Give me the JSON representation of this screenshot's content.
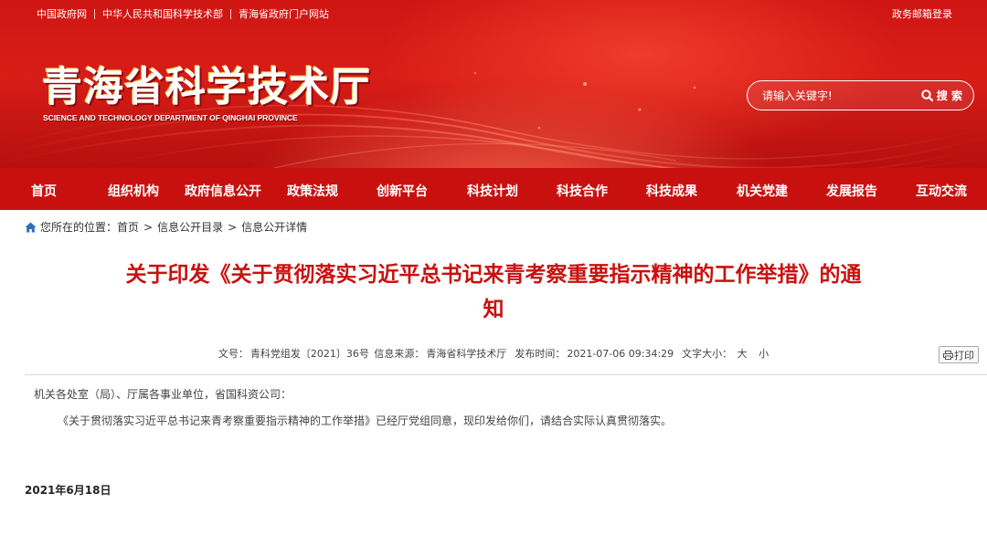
{
  "header": {
    "top_links": [
      "中国政府网",
      "中华人民共和国科学技术部",
      "青海省政府门户网站"
    ],
    "mailbox": "政务邮箱登录",
    "logo_cn": "青海省科学技术厅",
    "logo_en": "SCIENCE AND TECHNOLOGY DEPARTMENT OF QINGHAI PROVINCE",
    "search_placeholder": "请输入关键字!",
    "search_button": "搜 索"
  },
  "nav": {
    "items": [
      "首页",
      "组织机构",
      "政府信息公开",
      "政策法规",
      "创新平台",
      "科技计划",
      "科技合作",
      "科技成果",
      "机关党建",
      "发展报告",
      "互动交流"
    ]
  },
  "breadcrumb": {
    "prefix": "您所在的位置：",
    "items": [
      "首页",
      "信息公开目录",
      "信息公开详情"
    ],
    "separator": ">"
  },
  "article": {
    "title": "关于印发《关于贯彻落实习近平总书记来青考察重要指示精神的工作举措》的通知",
    "meta": {
      "doc_no_label": "文号：",
      "doc_no": "青科党组发〔2021〕36号",
      "source_label": "信息来源：",
      "source": "青海省科学技术厅",
      "time_label": "发布时间：",
      "time": "2021-07-06 09:34:29",
      "font_label": "文字大小：",
      "font_big": "大",
      "font_small": "小"
    },
    "print": "打印",
    "paragraph1": "机关各处室（局）、厅属各事业单位，省国科资公司：",
    "paragraph2": "《关于贯彻落实习近平总书记来青考察重要指示精神的工作举措》已经厅党组同意，现印发给你们，请结合实际认真贯彻落实。",
    "date": "2021年6月18日"
  },
  "colors": {
    "brand_red": "#c8110f",
    "title_red": "#c8110f"
  }
}
